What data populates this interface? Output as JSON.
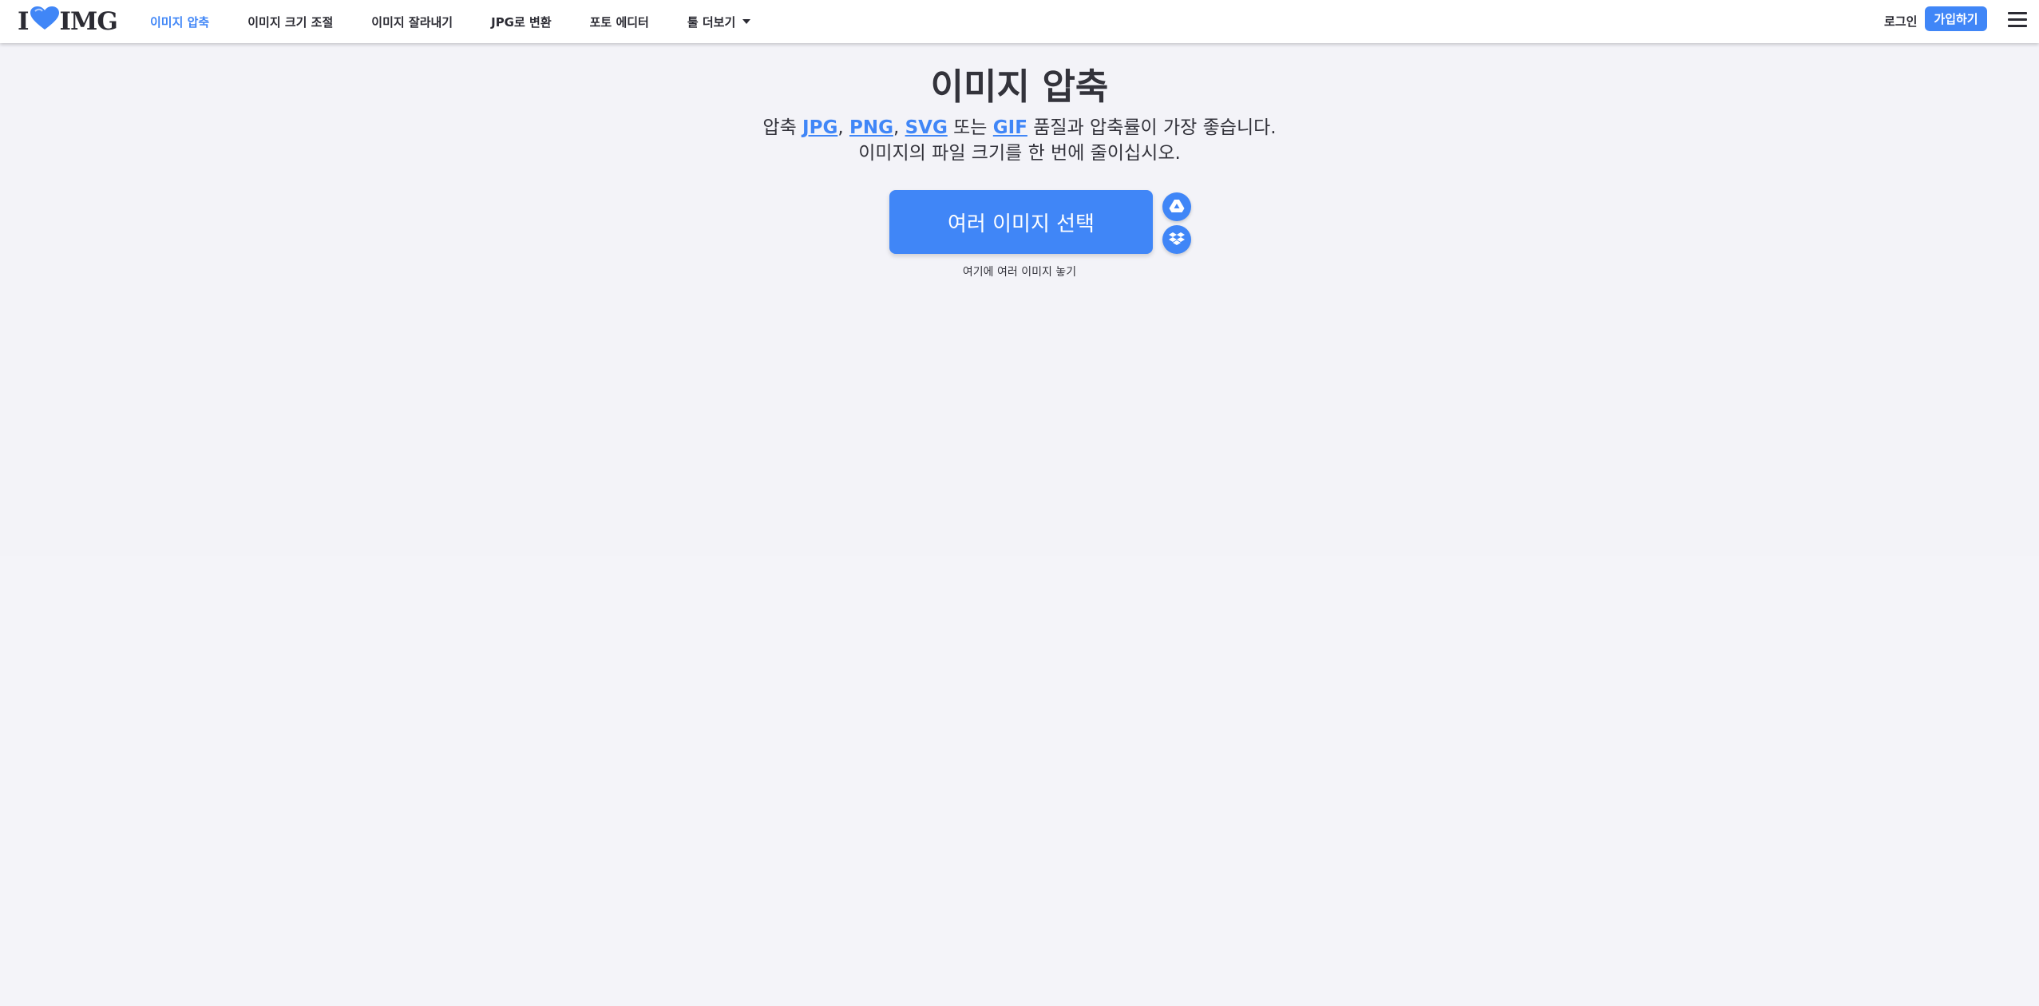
{
  "header": {
    "logo": {
      "prefix": "I",
      "suffix": "IMG"
    },
    "nav": [
      {
        "label": "이미지 압축",
        "active": true
      },
      {
        "label": "이미지 크기 조절",
        "active": false
      },
      {
        "label": "이미지 잘라내기",
        "active": false
      },
      {
        "label": "JPG로 변환",
        "active": false
      },
      {
        "label": "포토 에디터",
        "active": false
      },
      {
        "label": "툴 더보기",
        "active": false,
        "dropdown": true
      }
    ],
    "login_label": "로그인",
    "signup_label": "가입하기",
    "menu_icon": "hamburger-menu-icon"
  },
  "main": {
    "title": "이미지 압축",
    "subtitle": {
      "prefix": "압축",
      "formats": [
        "JPG",
        "PNG",
        "SVG",
        "GIF"
      ],
      "separator": ",",
      "conjunction": "또는",
      "suffix": "품질과 압축률이 가장 좋습니다.",
      "line2": "이미지의 파일 크기를 한 번에 줄이십시오."
    },
    "select_button_label": "여러 이미지 선택",
    "cloud_buttons": [
      {
        "icon": "google-drive-icon"
      },
      {
        "icon": "dropbox-icon"
      }
    ],
    "drop_hint": "여기에 여러 이미지 놓기"
  },
  "colors": {
    "accent": "#4086f7",
    "text": "#33333b",
    "background": "#f4f4f9",
    "header_bg": "#ffffff"
  }
}
